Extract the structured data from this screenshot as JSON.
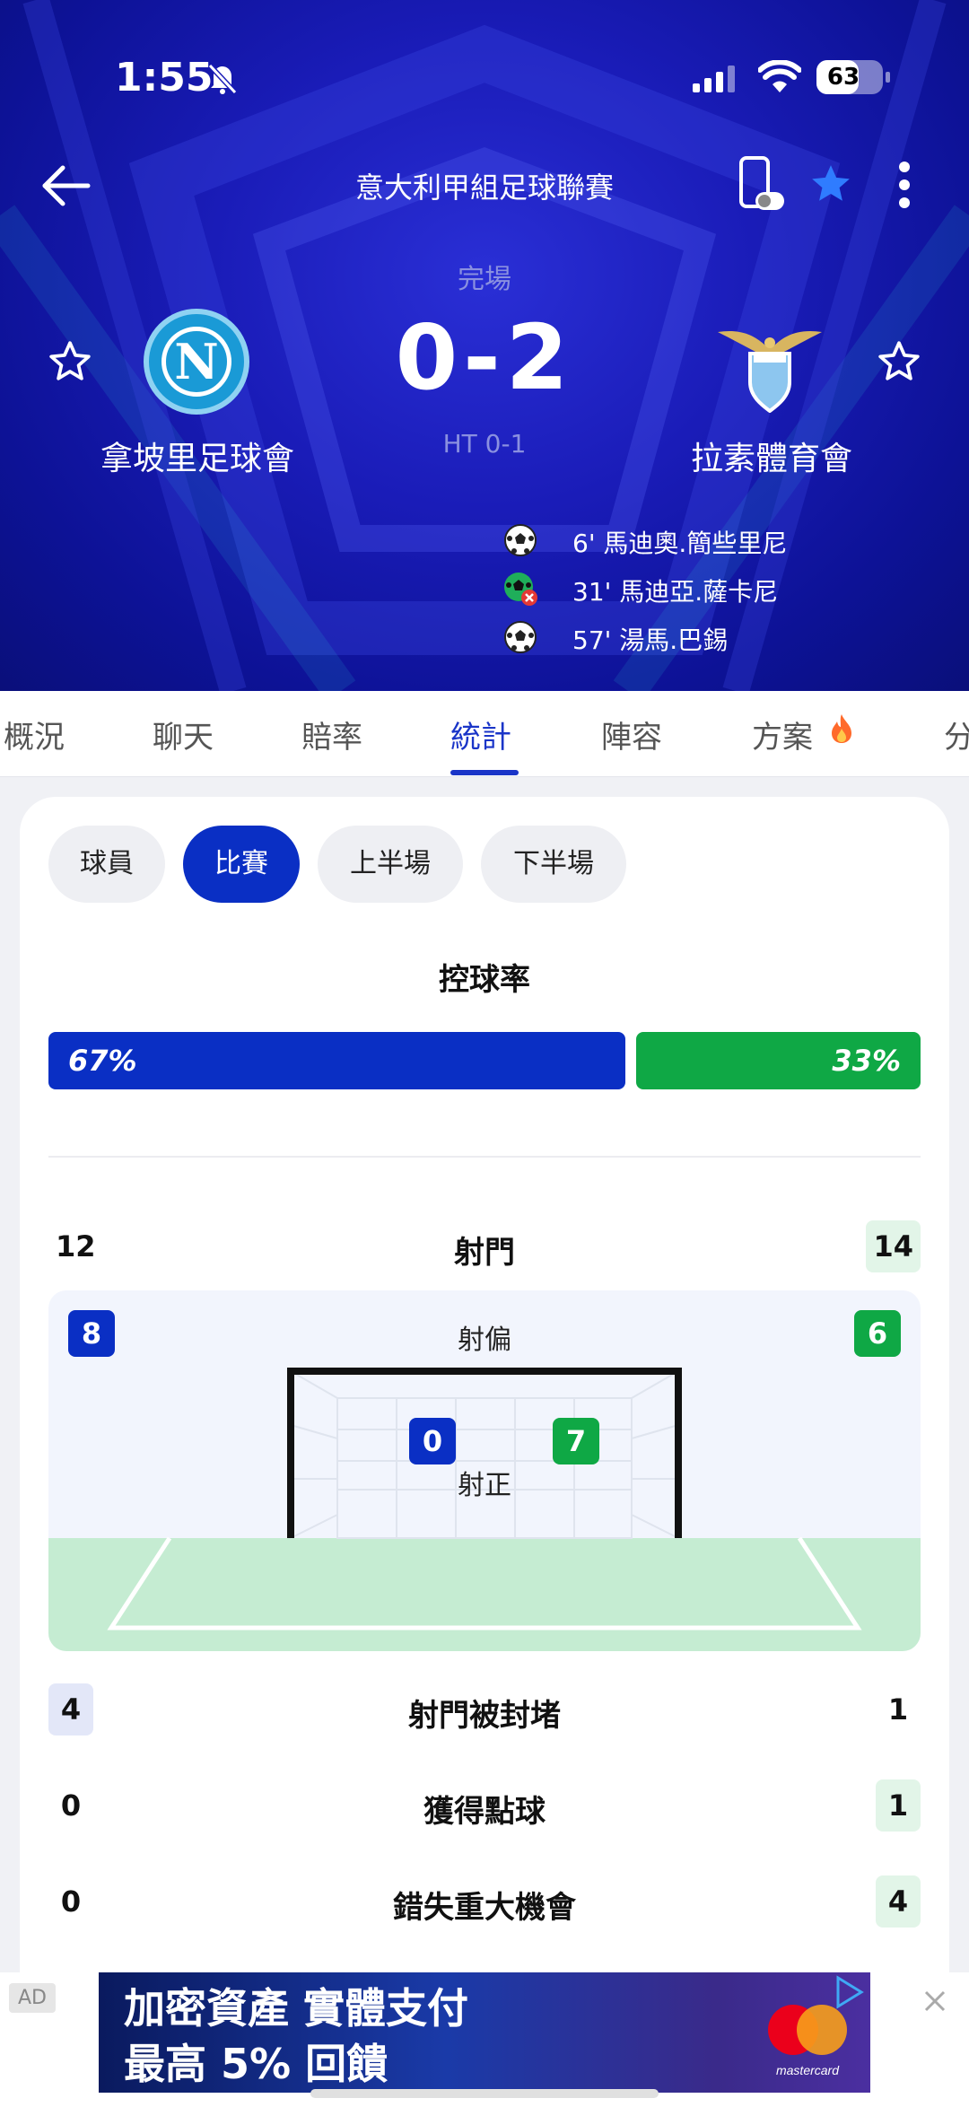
{
  "status_bar": {
    "time": "1:55",
    "battery": "63",
    "battery_level": 0.63
  },
  "header": {
    "league": "意大利甲組足球聯賽",
    "match_status": "完場",
    "score": "0-2",
    "half_time": "HT 0-1",
    "home_team": "拿坡里足球會",
    "away_team": "拉素體育會",
    "home_logo_letter": "N",
    "events": [
      {
        "icon": "goal-icon",
        "text": "6' 馬迪奧.簡些里尼"
      },
      {
        "icon": "own-goal-icon",
        "text": "31' 馬迪亞.薩卡尼"
      },
      {
        "icon": "goal-icon",
        "text": "57' 湯馬.巴錫"
      }
    ]
  },
  "tabs": [
    "概況",
    "聊天",
    "賠率",
    "統計",
    "陣容",
    "方案",
    "分"
  ],
  "active_tab": "統計",
  "filters": [
    "球員",
    "比賽",
    "上半場",
    "下半場"
  ],
  "active_filter": "比賽",
  "possession": {
    "title": "控球率",
    "home": "67%",
    "away": "33%",
    "home_value": 67,
    "away_value": 33
  },
  "stats": {
    "shots": {
      "label": "射門",
      "home": "12",
      "away": "14"
    },
    "off_target": {
      "label": "射偏",
      "home": "8",
      "away": "6"
    },
    "on_target": {
      "label": "射正",
      "home": "0",
      "away": "7"
    },
    "blocked": {
      "label": "射門被封堵",
      "home": "4",
      "away": "1"
    },
    "penalties": {
      "label": "獲得點球",
      "home": "0",
      "away": "1"
    },
    "big_chances_missed": {
      "label": "錯失重大機會",
      "home": "0",
      "away": "4"
    }
  },
  "ad": {
    "tag": "AD",
    "line1": "加密資產 實體支付",
    "line2": "最高 5% 回饋",
    "brand": "mastercard"
  },
  "colors": {
    "home": "#0a2fc4",
    "away": "#0fa845",
    "header_bg": "#1a1cb8",
    "accent": "#1a35c8"
  }
}
